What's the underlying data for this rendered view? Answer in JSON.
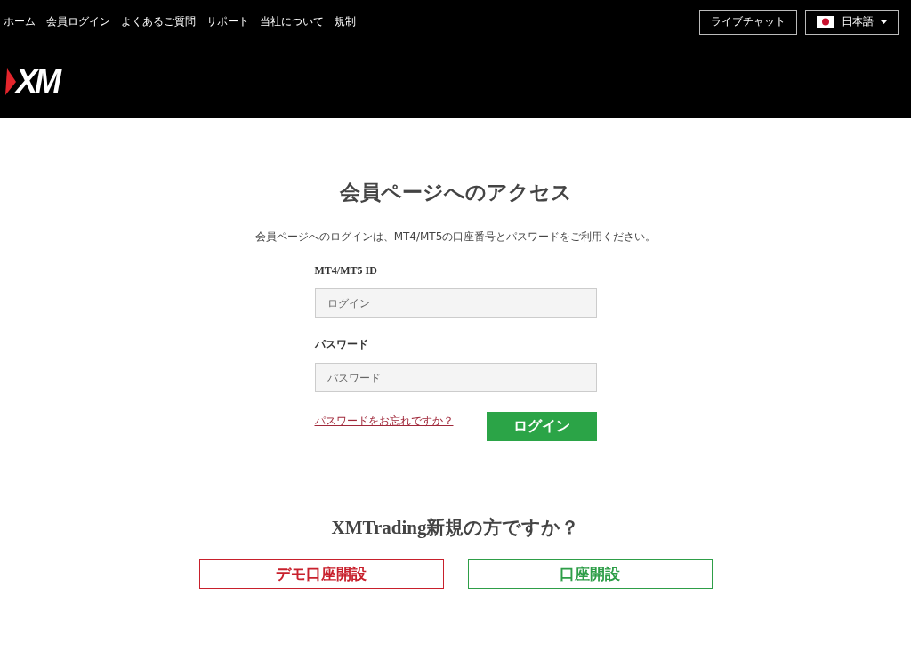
{
  "top_nav": {
    "links": [
      "ホーム",
      "会員ログイン",
      "よくあるご質問",
      "サポート",
      "当社について",
      "規制"
    ],
    "live_chat": "ライブチャット",
    "language": "日本語"
  },
  "logo": {
    "text": "XM"
  },
  "login": {
    "title": "会員ページへのアクセス",
    "intro": "会員ページへのログインは、MT4/MT5の口座番号とパスワードをご利用ください。",
    "fields": [
      {
        "label": "MT4/MT5 ID",
        "placeholder": "ログイン"
      },
      {
        "label": "パスワード",
        "placeholder": "パスワード"
      }
    ],
    "forgot_link": "パスワードをお忘れですか？",
    "submit": "ログイン"
  },
  "signup": {
    "title": "XMTrading新規の方ですか？",
    "buttons": [
      {
        "label": "デモ口座開設",
        "color": "#c8202c"
      },
      {
        "label": "口座開設",
        "color": "#2e9e48"
      }
    ]
  }
}
